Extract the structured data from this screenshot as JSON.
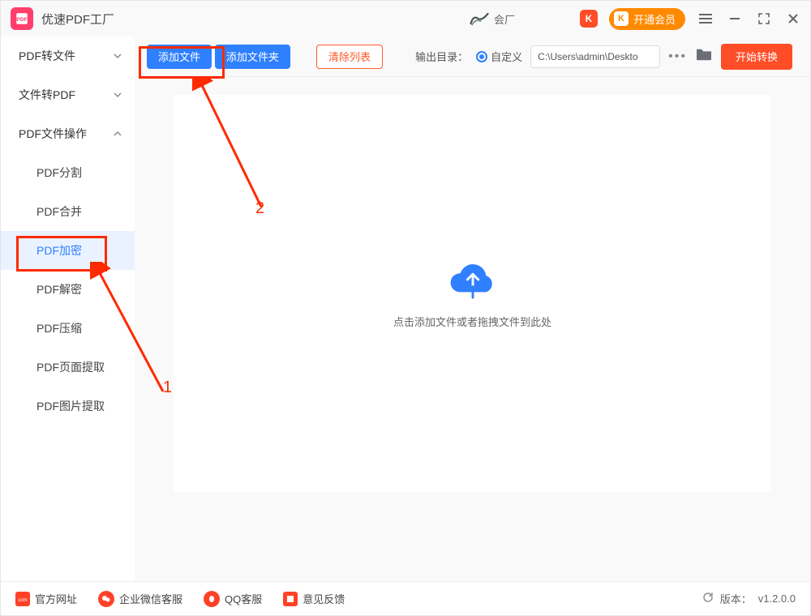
{
  "titlebar": {
    "app_name": "优速PDF工厂",
    "user_text": "会厂",
    "vip_label": "开通会员"
  },
  "toolbar": {
    "add_file": "添加文件",
    "add_folder": "添加文件夹",
    "clear_list": "清除列表",
    "output_label": "输出目录：",
    "output_radio": "自定义",
    "output_path": "C:\\Users\\admin\\Deskto",
    "start": "开始转换"
  },
  "sidebar": {
    "items": [
      {
        "label": "PDF转文件",
        "expanded": false
      },
      {
        "label": "文件转PDF",
        "expanded": false
      },
      {
        "label": "PDF文件操作",
        "expanded": true
      }
    ],
    "subitems": [
      "PDF分割",
      "PDF合并",
      "PDF加密",
      "PDF解密",
      "PDF压缩",
      "PDF页面提取",
      "PDF图片提取"
    ],
    "active_sub": "PDF加密"
  },
  "drop": {
    "hint": "点击添加文件或者拖拽文件到此处"
  },
  "footer": {
    "items": [
      "官方网址",
      "企业微信客服",
      "QQ客服",
      "意见反馈"
    ],
    "version_label": "版本：",
    "version": "v1.2.0.0"
  },
  "annotations": {
    "l1": "1",
    "l2": "2"
  }
}
